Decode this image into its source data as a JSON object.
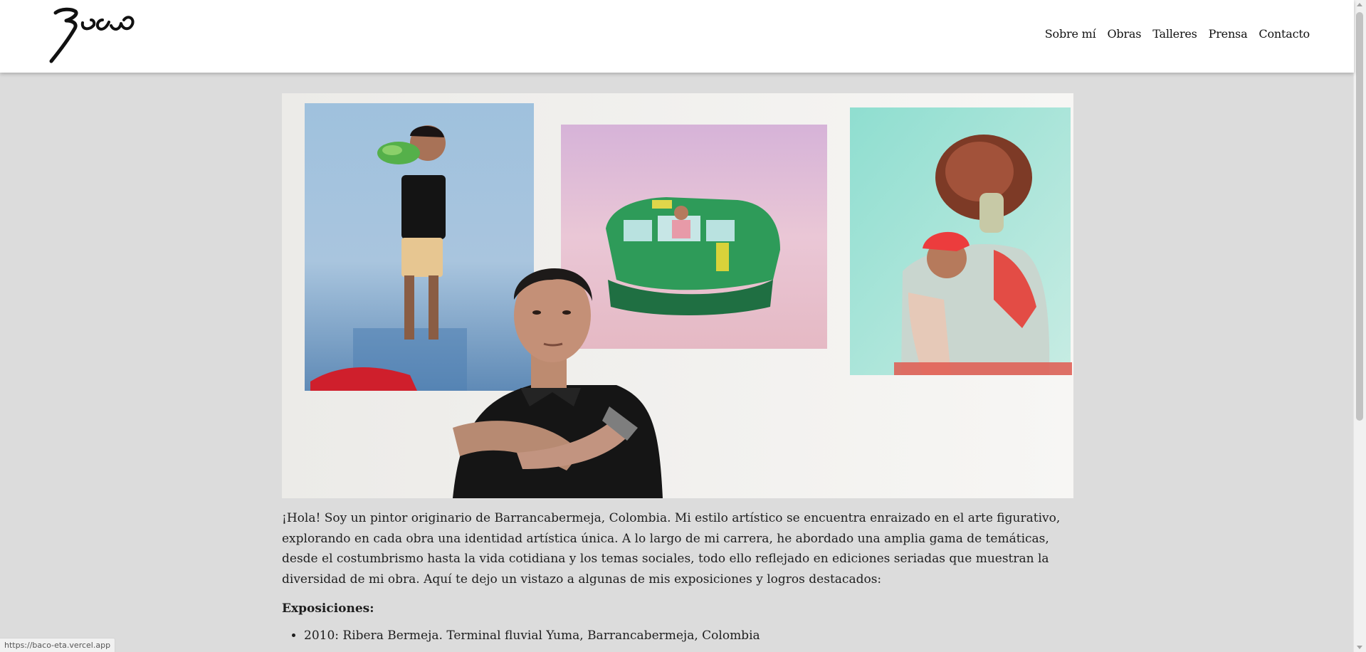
{
  "header": {
    "logo_text": "Baco",
    "nav": [
      {
        "label": "Sobre mí"
      },
      {
        "label": "Obras"
      },
      {
        "label": "Talleres"
      },
      {
        "label": "Prensa"
      },
      {
        "label": "Contacto"
      }
    ]
  },
  "main": {
    "intro": "¡Hola! Soy un pintor originario de Barrancabermeja, Colombia. Mi estilo artístico se encuentra enraizado en el arte figurativo, explorando en cada obra una identidad artística única. A lo largo de mi carrera, he abordado una amplia gama de temáticas, desde el costumbrismo hasta la vida cotidiana y los temas sociales, todo ello reflejado en ediciones seriadas que muestran la diversidad de mi obra. Aquí te dejo un vistazo a algunas de mis exposiciones y logros destacados:",
    "exhibitions_heading": "Exposiciones:",
    "exhibitions": [
      "2010: Ribera Bermeja. Terminal fluvial Yuma, Barrancabermeja, Colombia"
    ]
  },
  "status_url": "https://baco-eta.vercel.app",
  "colors": {
    "page_bg": "#dcdcdc",
    "header_bg": "#ffffff",
    "text": "#1e1e1e"
  }
}
